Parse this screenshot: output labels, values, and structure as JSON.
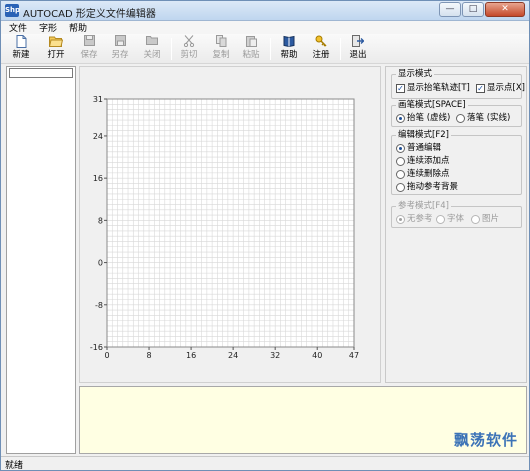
{
  "window": {
    "app_icon": "Shp",
    "title": "AUTOCAD 形定义文件编辑器",
    "controls": {
      "minimize": "—",
      "maximize": "□",
      "close": "✕"
    }
  },
  "menu": [
    "文件",
    "字形",
    "帮助"
  ],
  "toolbar": [
    {
      "label": "新建",
      "icon": "new-file-icon",
      "enabled": true
    },
    {
      "label": "打开",
      "icon": "open-folder-icon",
      "enabled": true
    },
    {
      "label": "保存",
      "icon": "save-icon",
      "enabled": false
    },
    {
      "label": "另存",
      "icon": "save-as-icon",
      "enabled": false
    },
    {
      "label": "关闭",
      "icon": "close-file-icon",
      "enabled": false
    },
    {
      "label": "剪切",
      "icon": "cut-icon",
      "enabled": false
    },
    {
      "label": "复制",
      "icon": "copy-icon",
      "enabled": false
    },
    {
      "label": "粘贴",
      "icon": "paste-icon",
      "enabled": false
    },
    {
      "label": "帮助",
      "icon": "help-book-icon",
      "enabled": true
    },
    {
      "label": "注册",
      "icon": "register-key-icon",
      "enabled": true
    },
    {
      "label": "退出",
      "icon": "exit-icon",
      "enabled": true
    }
  ],
  "grid": {
    "x_ticks": [
      "0",
      "8",
      "16",
      "24",
      "32",
      "40",
      "47"
    ],
    "y_ticks": [
      "31",
      "24",
      "16",
      "8",
      "0",
      "-8",
      "-16"
    ],
    "x_min": 0,
    "x_max": 47,
    "y_min": -16,
    "y_max": 31
  },
  "panel": {
    "display_mode": {
      "title": "显示模式",
      "options": [
        {
          "label": "显示抬笔轨迹[T]",
          "checked": true
        },
        {
          "label": "显示点[X]",
          "checked": true
        }
      ]
    },
    "pen_mode": {
      "title": "画笔模式[SPACE]",
      "options": [
        {
          "label": "抬笔 (虚线)",
          "selected": true
        },
        {
          "label": "落笔 (实线)",
          "selected": false
        }
      ]
    },
    "edit_mode": {
      "title": "编辑模式[F2]",
      "options": [
        {
          "label": "普通编辑",
          "selected": true
        },
        {
          "label": "连续添加点",
          "selected": false
        },
        {
          "label": "连续删除点",
          "selected": false
        },
        {
          "label": "拖动参考背景",
          "selected": false
        }
      ]
    },
    "ref_mode": {
      "title": "参考模式[F4]",
      "enabled": false,
      "options": [
        {
          "label": "无参考",
          "selected": true
        },
        {
          "label": "字体",
          "selected": false
        },
        {
          "label": "图片",
          "selected": false
        }
      ]
    }
  },
  "watermark": "飘荡软件",
  "status": "就绪",
  "colors": {
    "grid_minor": "#d8d8d8",
    "grid_major": "#8a8a8a",
    "text_area_bg": "#ffffe3",
    "accent": "#2a62b6"
  }
}
